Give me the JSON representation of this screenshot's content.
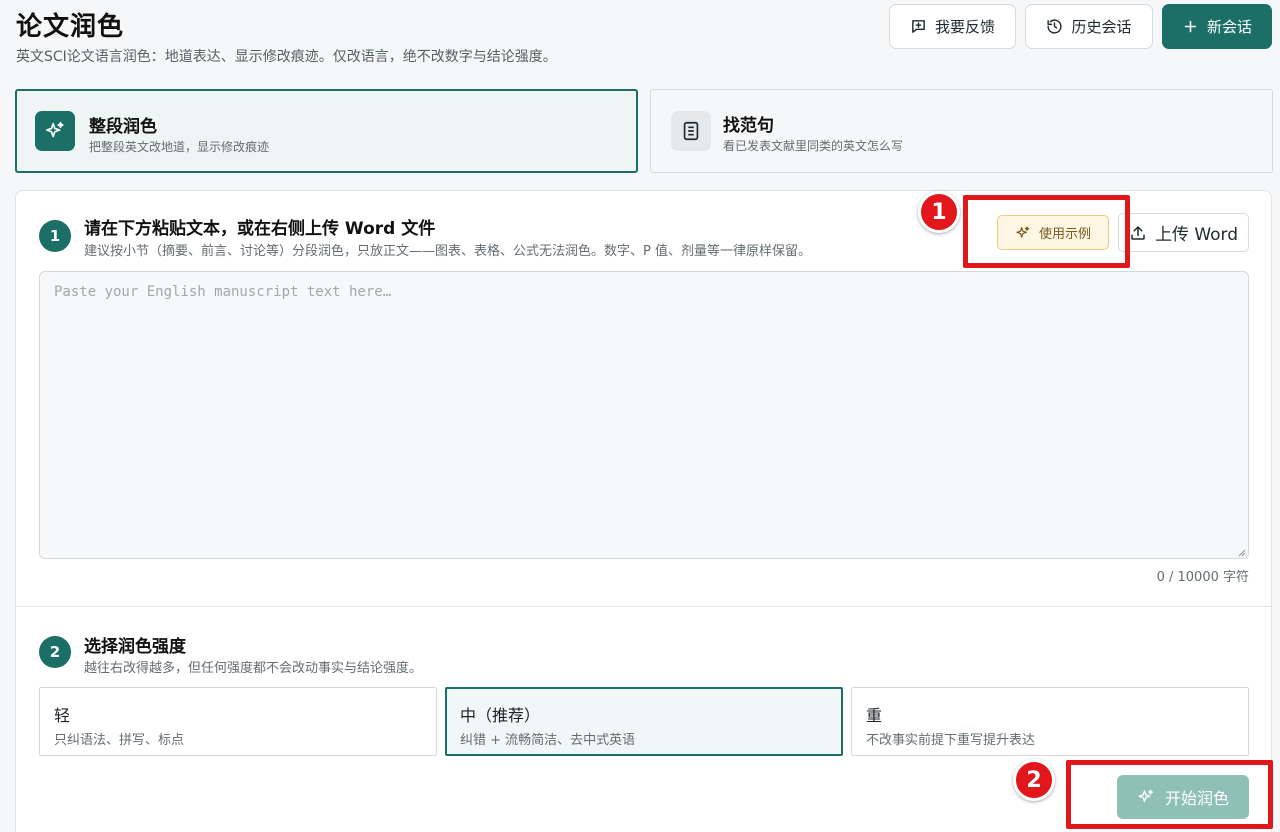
{
  "header": {
    "title": "论文润色",
    "subtitle": "英文SCI论文语言润色：地道表达、显示修改痕迹。仅改语言，绝不改数字与结论强度。",
    "buttons": {
      "feedback": "我要反馈",
      "history": "历史会话",
      "new_session": "新会话"
    }
  },
  "modes": [
    {
      "title": "整段润色",
      "description": "把整段英文改地道，显示修改痕迹",
      "selected": true,
      "icon": "sparkles-icon"
    },
    {
      "title": "找范句",
      "description": "看已发表文献里同类的英文怎么写",
      "selected": false,
      "icon": "document-icon"
    }
  ],
  "step1": {
    "number": "1",
    "title": "请在下方粘贴文本，或在右侧上传 Word 文件",
    "hint": "建议按小节（摘要、前言、讨论等）分段润色，只放正文——图表、表格、公式无法润色。数字、P 值、剂量等一律原样保留。",
    "example_button": "使用示例",
    "upload_button": "上传 Word",
    "textarea_value": "",
    "textarea_placeholder": "Paste your English manuscript text here…",
    "char_count": "0 / 10000 字符"
  },
  "step2": {
    "number": "2",
    "title": "选择润色强度",
    "hint": "越往右改得越多，但任何强度都不会改动事实与结论强度。",
    "levels": [
      {
        "name": "轻",
        "description": "只纠语法、拼写、标点",
        "selected": false
      },
      {
        "name": "中（推荐）",
        "description": "纠错 + 流畅简洁、去中式英语",
        "selected": true
      },
      {
        "name": "重",
        "description": "不改事实前提下重写提升表达",
        "selected": false
      }
    ],
    "start_button": "开始润色"
  },
  "annotations": {
    "badge_1": "1",
    "badge_2": "2",
    "color": "#e1171b"
  },
  "colors": {
    "accent": "#1b6f66",
    "start_button_disabled": "#8fc0b8",
    "example_button_bg": "#fdf6e3"
  }
}
